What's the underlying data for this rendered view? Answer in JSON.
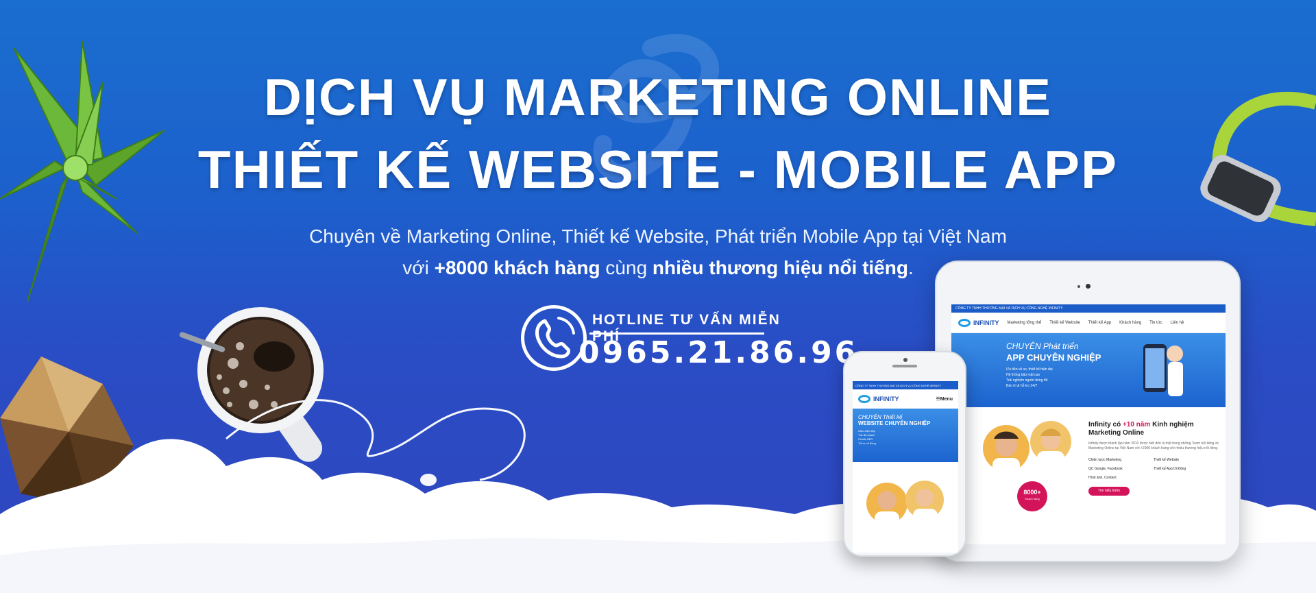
{
  "headline": {
    "line1": "DỊCH VỤ MARKETING ONLINE",
    "line2": "THIẾT KẾ WEBSITE - MOBILE APP"
  },
  "subtitle": {
    "line1": "Chuyên về Marketing Online, Thiết kế Website, Phát triển Mobile App tại Việt Nam",
    "line2_prefix": "với ",
    "line2_bold1": "+8000 khách hàng",
    "line2_middle": " cùng ",
    "line2_bold2": "nhiều thương hiệu nổi tiếng",
    "line2_suffix": "."
  },
  "hotline": {
    "label": "HOTLINE TƯ VẤN MIỄN PHÍ",
    "number": "0965.21.86.96",
    "icon": "phone-icon"
  },
  "tablet": {
    "topbar": "CÔNG TY TNHH THƯƠNG MẠI VÀ DỊCH VỤ CÔNG NGHỆ INFINITY",
    "brand": "INFINITY",
    "nav": [
      "Marketing tổng thể",
      "Thiết kế Website",
      "Thiết kế App",
      "Khách hàng",
      "Tin tức",
      "Liên hệ"
    ],
    "hero_line1": "CHUYÊN Phát triển",
    "hero_line2": "APP CHUYÊN NGHIỆP",
    "hero_points": [
      "Ưu tiên về ux, thiết kế hiện đại",
      "Hệ thống bảo mật cao",
      "Trải nghiệm người dùng tốt",
      "Bảo trì & hỗ trợ 24/7"
    ],
    "info_title_prefix": "Infinity có ",
    "info_title_highlight": "+10 năm",
    "info_title_suffix": " Kinh nghiệm Marketing Online",
    "info_paragraph": "Infinity được thành lập năm 2010 được biết đến là một trong những Team nổi tiếng về Marketing Online tại Việt Nam với +2000 khách hàng với nhiều thương hiệu nổi tiếng.",
    "services": [
      "Chiến lược Marketing",
      "Thiết kế Website",
      "QC Google, Facebook",
      "Thiết kế App Di Động",
      "Hình ảnh, Content",
      ""
    ],
    "button": "Tìm hiểu thêm",
    "badge_number": "8000+",
    "badge_label": "Khách hàng"
  },
  "phone": {
    "topbar": "CÔNG TY TNHH THƯƠNG MẠI VÀ DỊCH VỤ CÔNG NGHỆ INFINITY",
    "brand": "INFINITY",
    "menu": "☰Menu",
    "hero_line1": "CHUYÊN Thiết kế",
    "hero_line2": "WEBSITE CHUYÊN NGHIỆP",
    "hero_points": [
      "Giao diện đẹp",
      "Tốc độ nhanh",
      "Chuẩn SEO",
      "Tối ưu di động"
    ]
  },
  "colors": {
    "background_top": "#1a6ecf",
    "background_bottom": "#2f46bf",
    "accent_pink": "#d4145a",
    "watch_band": "#a9d43a"
  }
}
